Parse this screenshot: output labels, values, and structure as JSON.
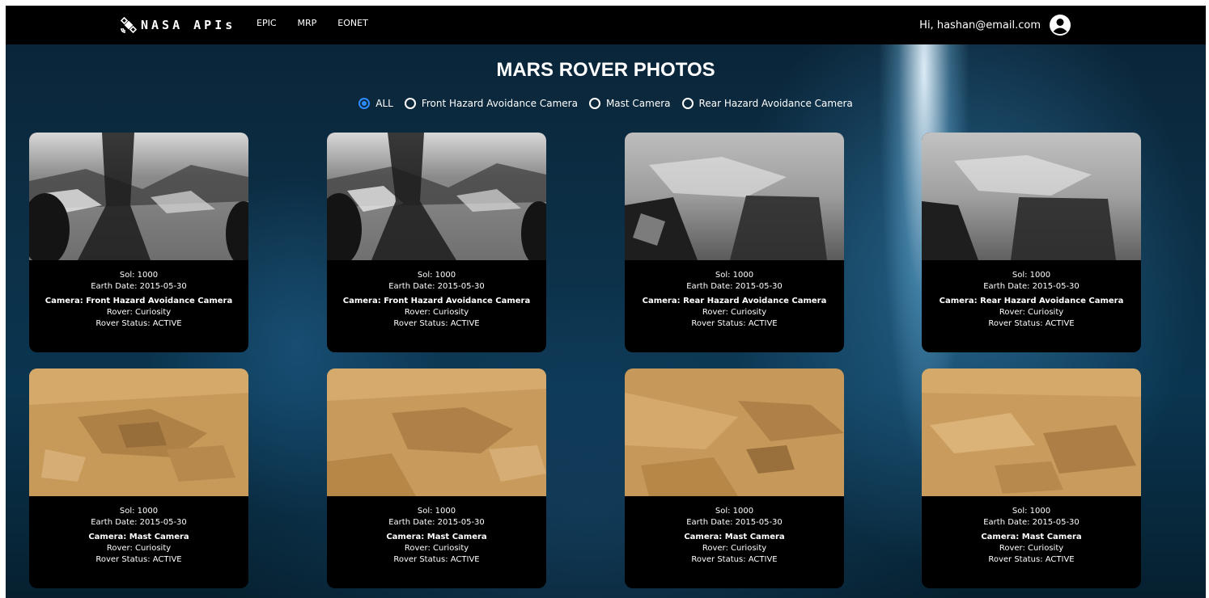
{
  "navbar": {
    "brand": "NASA APIs",
    "links": [
      "EPIC",
      "MRP",
      "EONET"
    ],
    "greeting": "Hi, hashan@email.com",
    "brand_icon": "satellite-icon",
    "avatar_icon": "user-circle-icon"
  },
  "page": {
    "title": "MARS ROVER PHOTOS"
  },
  "filters": {
    "options": [
      "ALL",
      "Front Hazard Avoidance Camera",
      "Mast Camera",
      "Rear Hazard Avoidance Camera"
    ],
    "selected": "ALL",
    "accent_color": "#2e8bff"
  },
  "cards": [
    {
      "sol": "Sol: 1000",
      "date": "Earth Date: 2015-05-30",
      "camera": "Camera: Front Hazard Avoidance Camera",
      "rover": "Rover: Curiosity",
      "status": "Rover Status: ACTIVE",
      "photo_kind": "front-hazcam-grayscale"
    },
    {
      "sol": "Sol: 1000",
      "date": "Earth Date: 2015-05-30",
      "camera": "Camera: Front Hazard Avoidance Camera",
      "rover": "Rover: Curiosity",
      "status": "Rover Status: ACTIVE",
      "photo_kind": "front-hazcam-grayscale"
    },
    {
      "sol": "Sol: 1000",
      "date": "Earth Date: 2015-05-30",
      "camera": "Camera: Rear Hazard Avoidance Camera",
      "rover": "Rover: Curiosity",
      "status": "Rover Status: ACTIVE",
      "photo_kind": "rear-hazcam-grayscale"
    },
    {
      "sol": "Sol: 1000",
      "date": "Earth Date: 2015-05-30",
      "camera": "Camera: Rear Hazard Avoidance Camera",
      "rover": "Rover: Curiosity",
      "status": "Rover Status: ACTIVE",
      "photo_kind": "rear-hazcam-grayscale"
    },
    {
      "sol": "Sol: 1000",
      "date": "Earth Date: 2015-05-30",
      "camera": "Camera: Mast Camera",
      "rover": "Rover: Curiosity",
      "status": "Rover Status: ACTIVE",
      "photo_kind": "mastcam-color"
    },
    {
      "sol": "Sol: 1000",
      "date": "Earth Date: 2015-05-30",
      "camera": "Camera: Mast Camera",
      "rover": "Rover: Curiosity",
      "status": "Rover Status: ACTIVE",
      "photo_kind": "mastcam-color"
    },
    {
      "sol": "Sol: 1000",
      "date": "Earth Date: 2015-05-30",
      "camera": "Camera: Mast Camera",
      "rover": "Rover: Curiosity",
      "status": "Rover Status: ACTIVE",
      "photo_kind": "mastcam-color"
    },
    {
      "sol": "Sol: 1000",
      "date": "Earth Date: 2015-05-30",
      "camera": "Camera: Mast Camera",
      "rover": "Rover: Curiosity",
      "status": "Rover Status: ACTIVE",
      "photo_kind": "mastcam-color"
    }
  ]
}
